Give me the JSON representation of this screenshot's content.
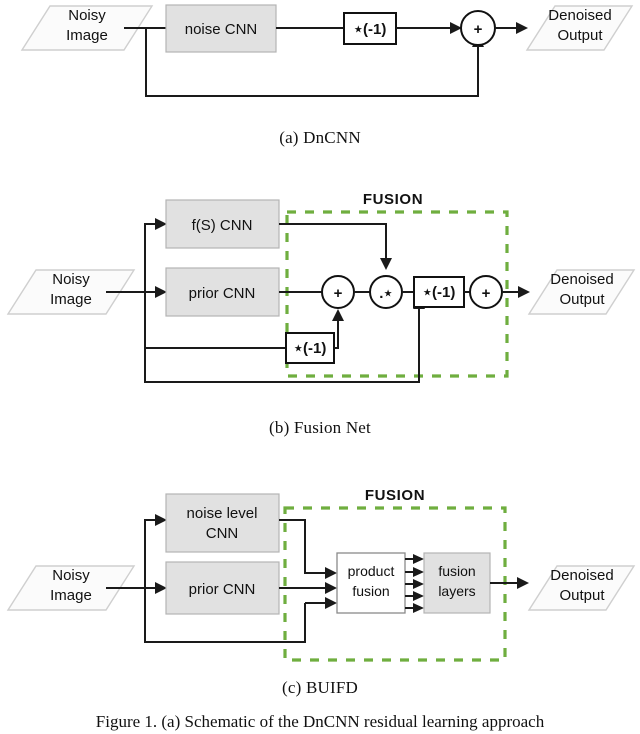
{
  "figure": {
    "caption": "Figure 1.  (a) Schematic of the DnCNN residual learning approach"
  },
  "panels": [
    {
      "id": "a",
      "subcaption": "(a)  DnCNN",
      "input_label_line1": "Noisy",
      "input_label_line2": "Image",
      "output_label_line1": "Denoised",
      "output_label_line2": "Output",
      "cnn_label": "noise CNN",
      "negate_label": "⋆(-1)",
      "sum_label": "+"
    },
    {
      "id": "b",
      "subcaption": "(b)  Fusion Net",
      "input_label_line1": "Noisy",
      "input_label_line2": "Image",
      "output_label_line1": "Denoised",
      "output_label_line2": "Output",
      "cnn_top_label": "f(S) CNN",
      "cnn_bottom_label": "prior CNN",
      "fusion_label": "FUSION",
      "sum1_label": "+",
      "product_label": ".⋆",
      "negate_inline_label": "⋆(-1)",
      "negate_skip_label": "⋆(-1)",
      "sum2_label": "+"
    },
    {
      "id": "c",
      "subcaption": "(c)  BUIFD",
      "input_label_line1": "Noisy",
      "input_label_line2": "Image",
      "output_label_line1": "Denoised",
      "output_label_line2": "Output",
      "cnn_top_label_line1": "noise level",
      "cnn_top_label_line2": "CNN",
      "cnn_bottom_label": "prior CNN",
      "fusion_label": "FUSION",
      "product_fusion_line1": "product",
      "product_fusion_line2": "fusion",
      "fusion_layers_line1": "fusion",
      "fusion_layers_line2": "layers"
    }
  ],
  "colors": {
    "fusion_green": "#6fae3f",
    "cnn_box_fill": "#e1e1e1",
    "io_shape_fill": "#fbfbfb",
    "wire": "#1a1a1a",
    "text": "#111111"
  }
}
